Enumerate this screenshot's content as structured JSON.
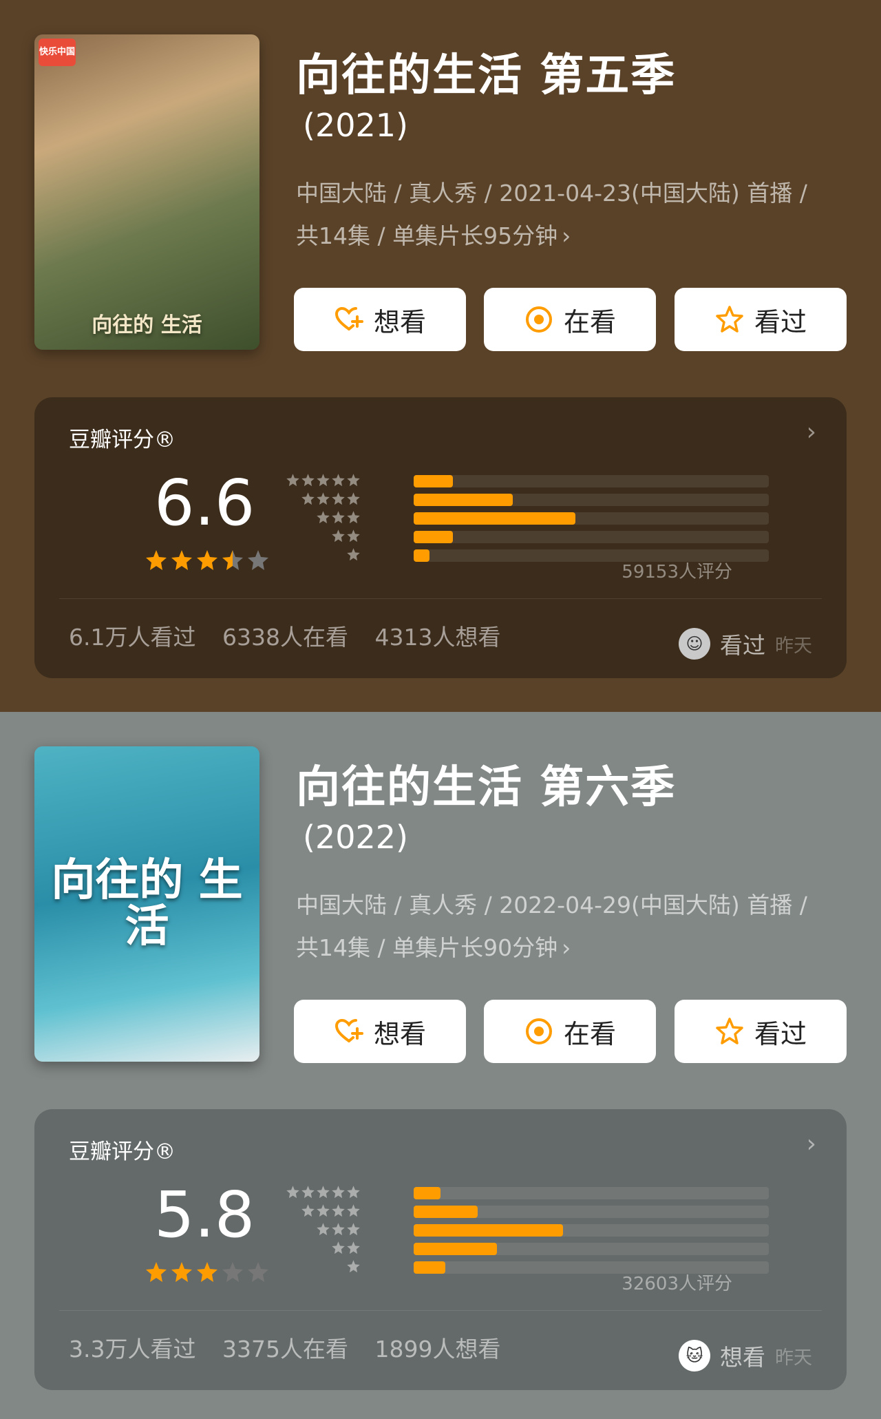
{
  "shows": [
    {
      "poster_text": "向往的\n生活",
      "poster_badge": "快乐中国",
      "title": "向往的生活 第五季",
      "year": "(2021)",
      "meta_line1": "中国大陆 / 真人秀 / 2021-04-23(中国大陆) 首播 /",
      "meta_line2": "共14集 / 单集片长95分钟",
      "buttons": {
        "want": "想看",
        "watching": "在看",
        "watched": "看过"
      },
      "rating_label": "豆瓣评分®",
      "score": "6.6",
      "star_fill": [
        1,
        1,
        1,
        0.5,
        0
      ],
      "distribution": [
        0.11,
        0.28,
        0.455,
        0.11,
        0.045
      ],
      "total_ratings": "59153人评分",
      "stats": {
        "watched": "6.1万人看过",
        "watching": "6338人在看",
        "want": "4313人想看"
      },
      "user_action": "看过",
      "user_time": "昨天"
    },
    {
      "poster_text": "向往的\n生活",
      "title": "向往的生活 第六季",
      "year": "(2022)",
      "meta_line1": "中国大陆 / 真人秀 / 2022-04-29(中国大陆) 首播 /",
      "meta_line2": "共14集 / 单集片长90分钟",
      "buttons": {
        "want": "想看",
        "watching": "在看",
        "watched": "看过"
      },
      "rating_label": "豆瓣评分®",
      "score": "5.8",
      "star_fill": [
        1,
        1,
        1,
        0,
        0
      ],
      "distribution": [
        0.075,
        0.18,
        0.42,
        0.235,
        0.09
      ],
      "total_ratings": "32603人评分",
      "stats": {
        "watched": "3.3万人看过",
        "watching": "3375人在看",
        "want": "1899人想看"
      },
      "user_action": "想看",
      "user_time": "昨天"
    }
  ],
  "colors": {
    "accent": "#ff9c00",
    "star_empty": "#777777"
  },
  "icons": [
    "heart-plus-icon",
    "target-icon",
    "star-icon",
    "chevron-right-icon",
    "avatar"
  ]
}
